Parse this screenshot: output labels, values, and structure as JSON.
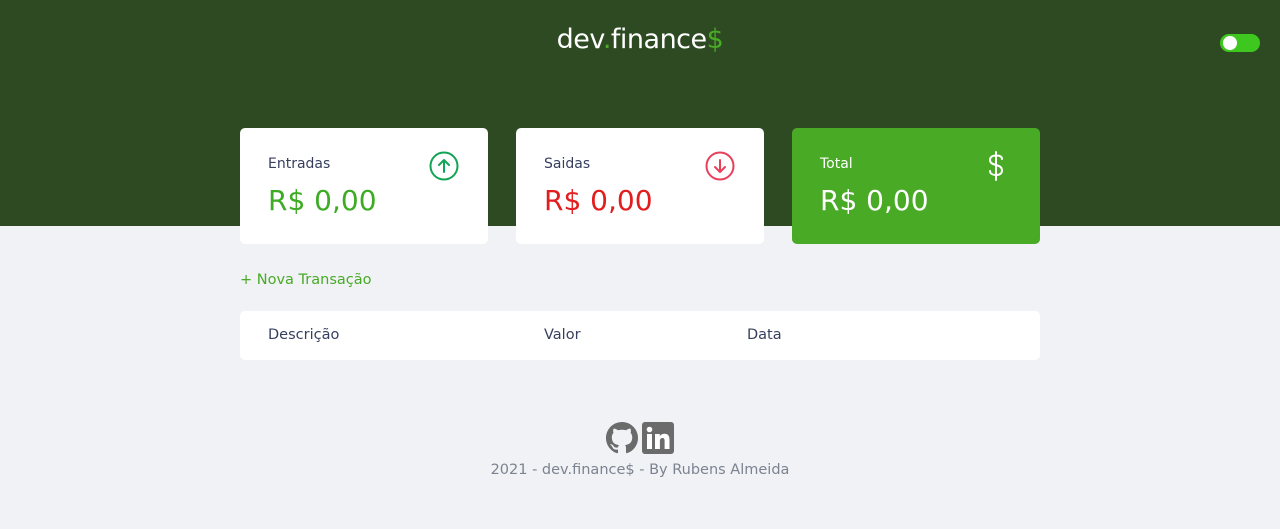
{
  "header": {
    "logo_prefix": "dev",
    "logo_dot": ".",
    "logo_word": "finance",
    "logo_dollar": "$",
    "theme_toggle_on": true
  },
  "cards": {
    "income": {
      "label": "Entradas",
      "amount": "R$ 0,00",
      "icon": "arrow-up-circle-icon"
    },
    "expense": {
      "label": "Saidas",
      "amount": "R$ 0,00",
      "icon": "arrow-down-circle-icon"
    },
    "total": {
      "label": "Total",
      "amount": "R$ 0,00",
      "icon": "dollar-sign-icon"
    }
  },
  "actions": {
    "new_transaction": "+ Nova Transação"
  },
  "table": {
    "columns": [
      "Descrição",
      "Valor",
      "Data"
    ]
  },
  "footer": {
    "credit": "2021 - dev.finance$ - By Rubens Almeida",
    "icons": [
      "github-icon",
      "linkedin-icon"
    ]
  },
  "colors": {
    "header_bg": "#2d4a22",
    "accent_green": "#49aa26",
    "income_green": "#3dab23",
    "expense_red": "#e21d1d",
    "page_bg": "#f0f2f5"
  }
}
